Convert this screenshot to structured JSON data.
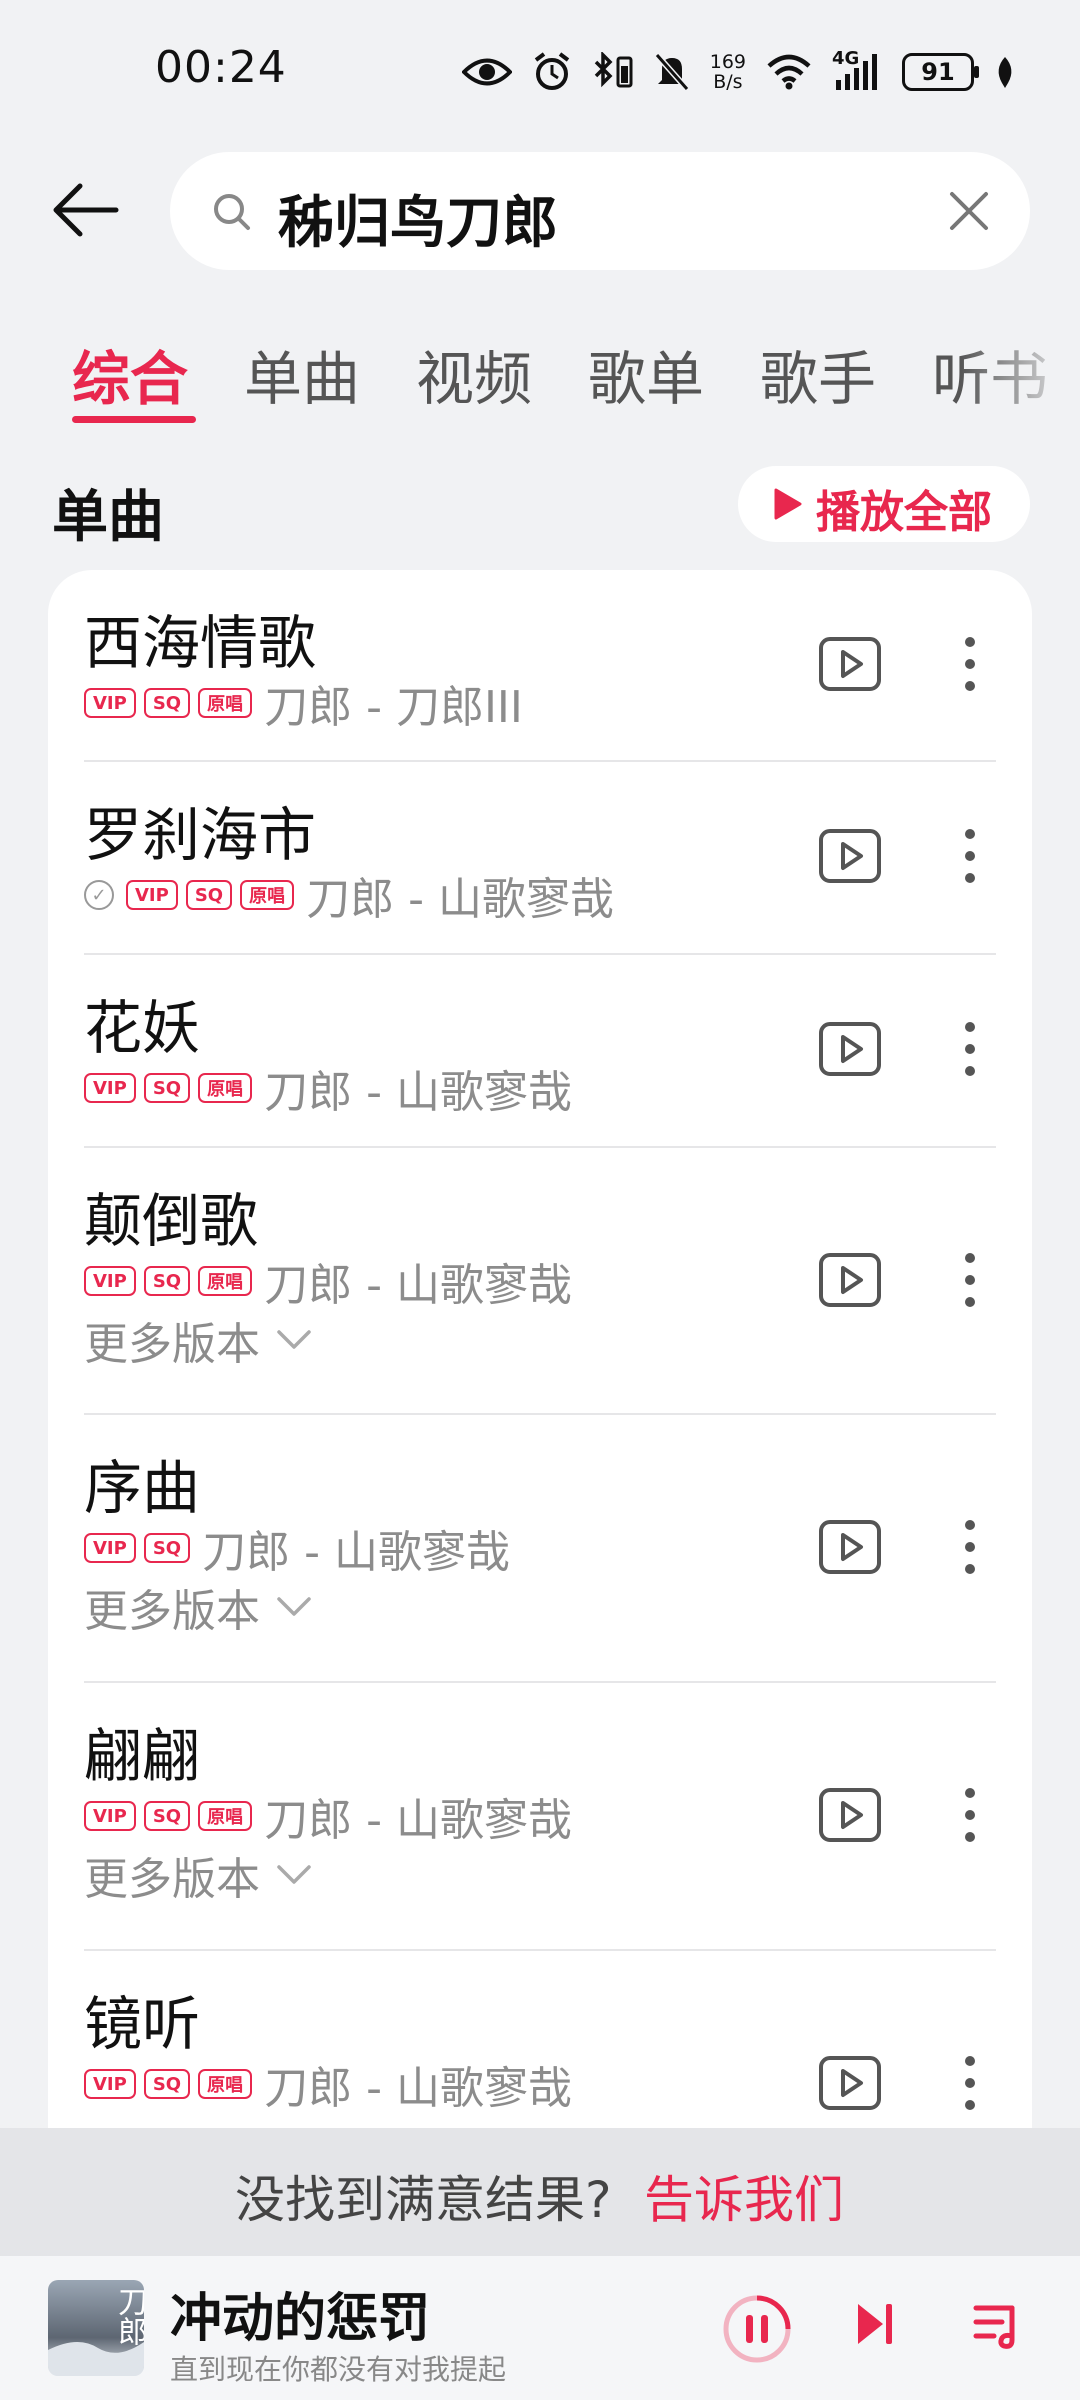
{
  "status_bar": {
    "time": "00:24",
    "net_speed_top": "169",
    "net_speed_bottom": "B/s",
    "network_type": "4G",
    "battery": "91"
  },
  "search": {
    "query": "秭归鸟刀郎"
  },
  "tabs": [
    {
      "label": "综合",
      "active": true
    },
    {
      "label": "单曲"
    },
    {
      "label": "视频"
    },
    {
      "label": "歌单"
    },
    {
      "label": "歌手"
    },
    {
      "label": "听书"
    }
  ],
  "section": {
    "title": "单曲",
    "play_all": "播放全部"
  },
  "badges": {
    "vip": "VIP",
    "sq": "SQ",
    "original": "原唱"
  },
  "songs": [
    {
      "title": "西海情歌",
      "meta": "刀郎 - 刀郎III",
      "badges": [
        "VIP",
        "SQ",
        "原唱"
      ],
      "downloaded": false,
      "more_versions": ""
    },
    {
      "title": "罗刹海市",
      "meta": "刀郎 - 山歌寥哉",
      "badges": [
        "VIP",
        "SQ",
        "原唱"
      ],
      "downloaded": true,
      "more_versions": ""
    },
    {
      "title": "花妖",
      "meta": "刀郎 - 山歌寥哉",
      "badges": [
        "VIP",
        "SQ",
        "原唱"
      ],
      "downloaded": false,
      "more_versions": ""
    },
    {
      "title": "颠倒歌",
      "meta": "刀郎 - 山歌寥哉",
      "badges": [
        "VIP",
        "SQ",
        "原唱"
      ],
      "downloaded": false,
      "more_versions": "更多版本"
    },
    {
      "title": "序曲",
      "meta": "刀郎 - 山歌寥哉",
      "badges": [
        "VIP",
        "SQ"
      ],
      "downloaded": false,
      "more_versions": "更多版本"
    },
    {
      "title": "翩翩",
      "meta": "刀郎 - 山歌寥哉",
      "badges": [
        "VIP",
        "SQ",
        "原唱"
      ],
      "downloaded": false,
      "more_versions": "更多版本"
    },
    {
      "title": "镜听",
      "meta": "刀郎 - 山歌寥哉",
      "badges": [
        "VIP",
        "SQ",
        "原唱"
      ],
      "downloaded": false,
      "more_versions": ""
    }
  ],
  "feedback": {
    "question": "没找到满意结果?",
    "link": "告诉我们"
  },
  "player": {
    "title": "冲动的惩罚",
    "subtitle": "直到现在你都没有对我提起",
    "cover_text": "刀郎",
    "state": "playing"
  },
  "colors": {
    "accent": "#e8274e",
    "background": "#f1f2f4",
    "card": "#ffffff",
    "secondary_text": "#8c8c8c"
  },
  "icons": [
    "eye-icon",
    "alarm-icon",
    "bluetooth-icon",
    "mute-icon",
    "wifi-icon",
    "signal-icon",
    "battery-icon",
    "leaf-icon",
    "back-arrow-icon",
    "search-icon",
    "clear-icon",
    "play-icon",
    "mv-icon",
    "more-vertical-icon",
    "chevron-down-icon",
    "check-circle-icon",
    "pause-icon",
    "next-icon",
    "playlist-icon"
  ]
}
